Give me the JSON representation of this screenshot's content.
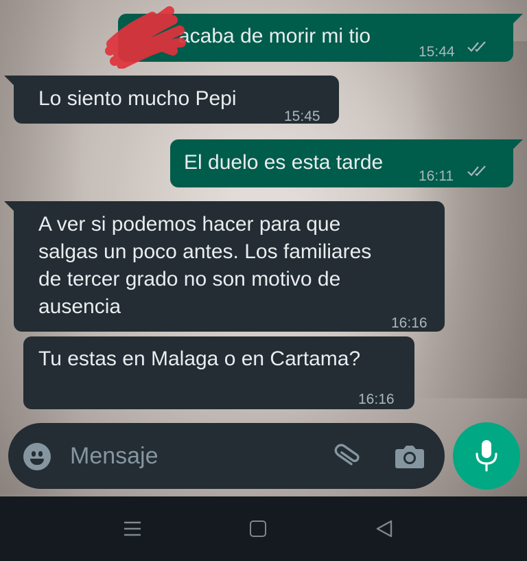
{
  "messages": [
    {
      "direction": "outgoing",
      "text": "acaba de morir mi tio",
      "time": "15:44",
      "status": "read"
    },
    {
      "direction": "incoming",
      "text": "Lo siento mucho Pepi",
      "time": "15:45"
    },
    {
      "direction": "outgoing",
      "text": "El duelo es esta tarde",
      "time": "16:11",
      "status": "read"
    },
    {
      "direction": "incoming",
      "text": "A ver si podemos hacer para que\nsalgas un poco antes. Los familiares\nde tercer grado no son motivo de\nausencia",
      "time": "16:16"
    },
    {
      "direction": "incoming",
      "text": "Tu estas en Malaga o en Cartama?",
      "time": "16:16"
    }
  ],
  "composer": {
    "placeholder": "Mensaje",
    "icons": [
      "emoji-icon",
      "paperclip-icon",
      "camera-icon",
      "microphone-icon"
    ]
  },
  "navbar": {
    "icons": [
      "menu-icon",
      "home-icon",
      "back-icon"
    ]
  },
  "colors": {
    "outgoing_bubble": "#005c4b",
    "incoming_bubble": "#232d33",
    "mic_button": "#00a884",
    "read_ticks": "#a9b8bf"
  }
}
